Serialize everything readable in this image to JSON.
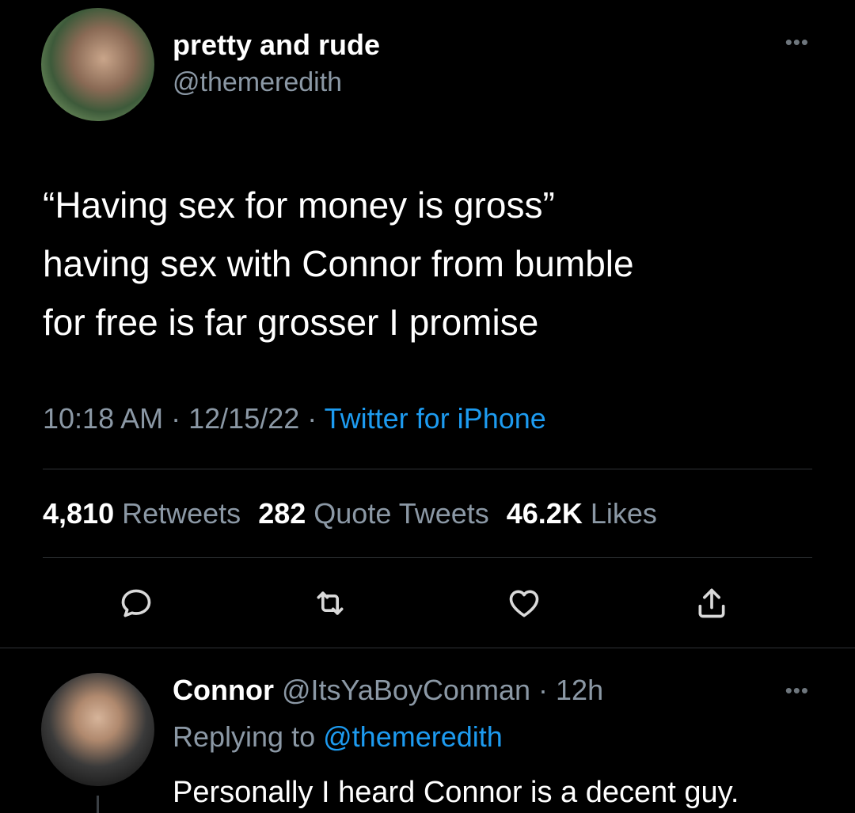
{
  "tweet": {
    "display_name": "pretty and rude",
    "handle": "@themeredith",
    "more_label": "•••",
    "text_lines": [
      "“Having sex for money is gross”",
      "having sex with Connor from bumble",
      "for free is far grosser I promise"
    ],
    "time": "10:18 AM",
    "separator": "·",
    "date": "12/15/22",
    "source": "Twitter for iPhone",
    "stats": {
      "retweets_count": "4,810",
      "retweets_label": "Retweets",
      "quotes_count": "282",
      "quotes_label": "Quote Tweets",
      "likes_count": "46.2K",
      "likes_label": "Likes"
    },
    "actions": {
      "reply_icon": "reply-icon",
      "retweet_icon": "retweet-icon",
      "like_icon": "heart-icon",
      "share_icon": "share-icon"
    }
  },
  "reply": {
    "display_name": "Connor",
    "handle": "@ItsYaBoyConman",
    "separator": "·",
    "time": "12h",
    "more_label": "•••",
    "replying_label": "Replying to",
    "replying_to": "@themeredith",
    "text": "Personally I heard Connor is a decent guy."
  },
  "colors": {
    "background": "#000000",
    "text": "#ffffff",
    "secondary": "#8b98a5",
    "accent": "#1d9bf0",
    "divider": "#2f3336"
  }
}
